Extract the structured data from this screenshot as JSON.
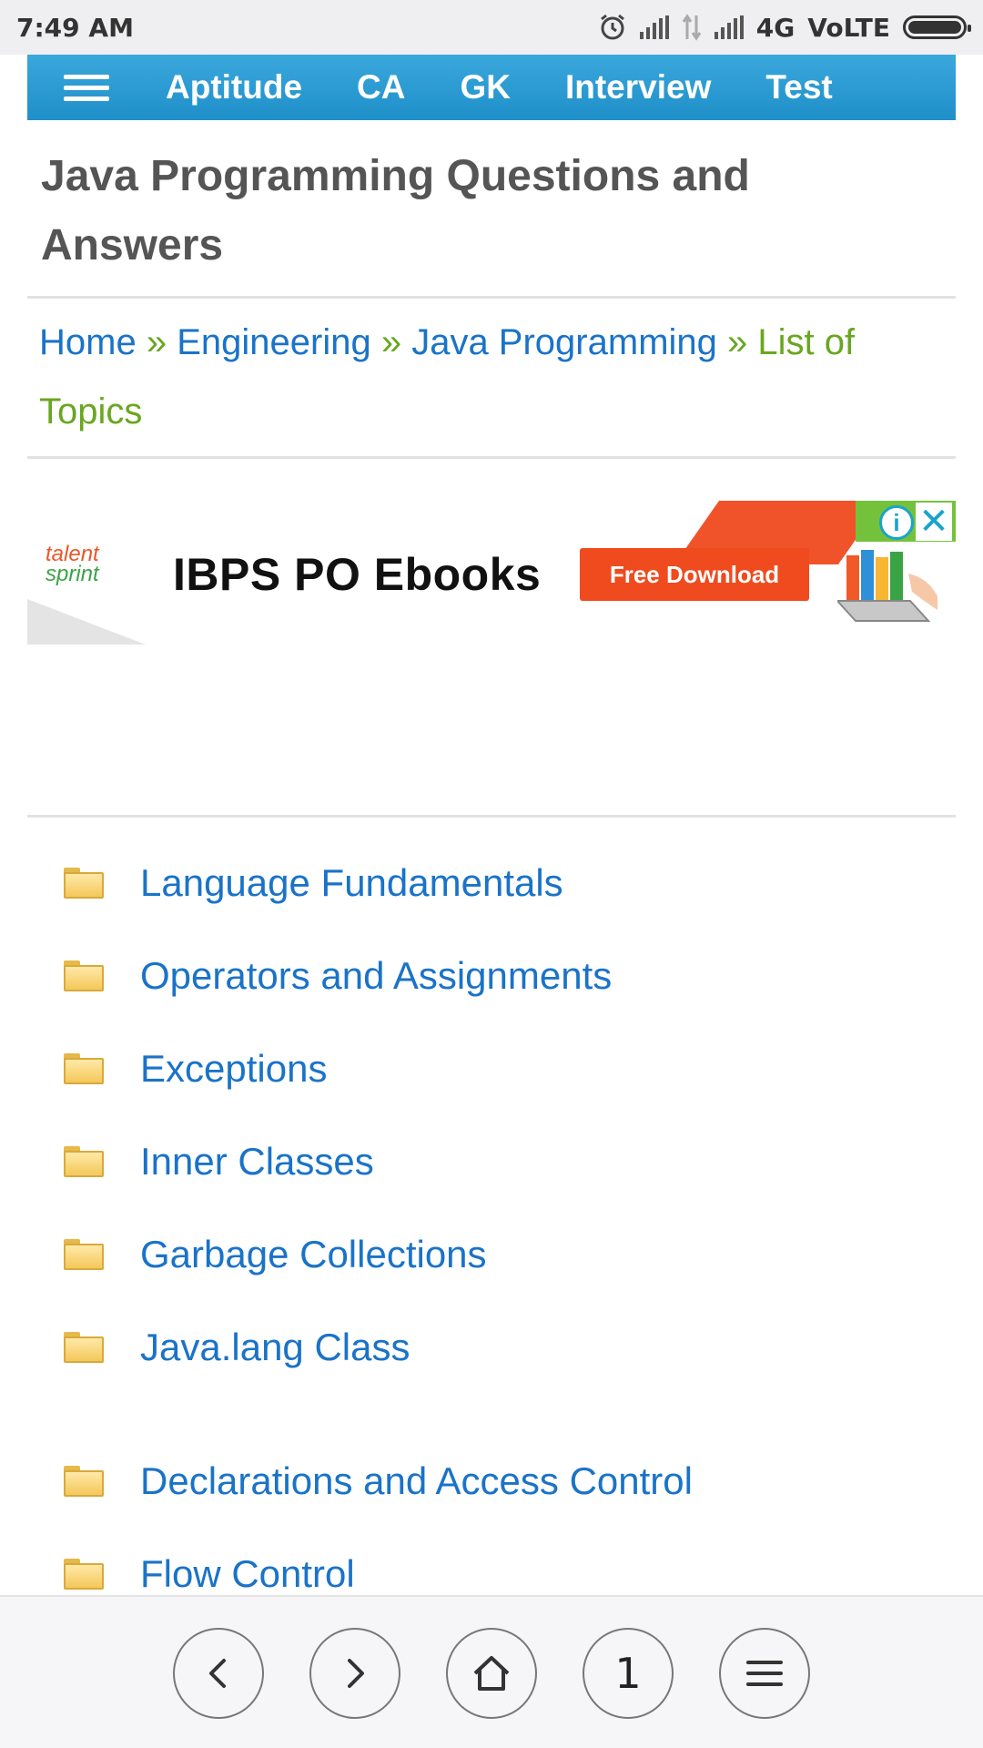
{
  "status_bar": {
    "time": "7:49 AM",
    "network": "4G",
    "volte": "VoLTE"
  },
  "nav": {
    "items": [
      "Aptitude",
      "CA",
      "GK",
      "Interview",
      "Test"
    ]
  },
  "page": {
    "title": "Java Programming Questions and Answers"
  },
  "breadcrumb": {
    "items": [
      "Home",
      "Engineering",
      "Java Programming"
    ],
    "separator": "»",
    "current": "List of Topics"
  },
  "ad": {
    "logo_line1": "talent",
    "logo_line2": "sprint",
    "headline": "IBPS PO Ebooks",
    "cta": "Free Download",
    "info_icon": "i",
    "close_icon": "✕"
  },
  "topics": [
    "Language Fundamentals",
    "Operators and Assignments",
    "Exceptions",
    "Inner Classes",
    "Garbage Collections",
    "Java.lang Class",
    "Declarations and Access Control",
    "Flow Control"
  ],
  "bottom_bar": {
    "tab_count": "1"
  },
  "colors": {
    "nav_blue": "#2a9dd5",
    "link_blue": "#1a73c8",
    "breadcrumb_green": "#6aa621",
    "cta_orange": "#ef4b1f"
  }
}
